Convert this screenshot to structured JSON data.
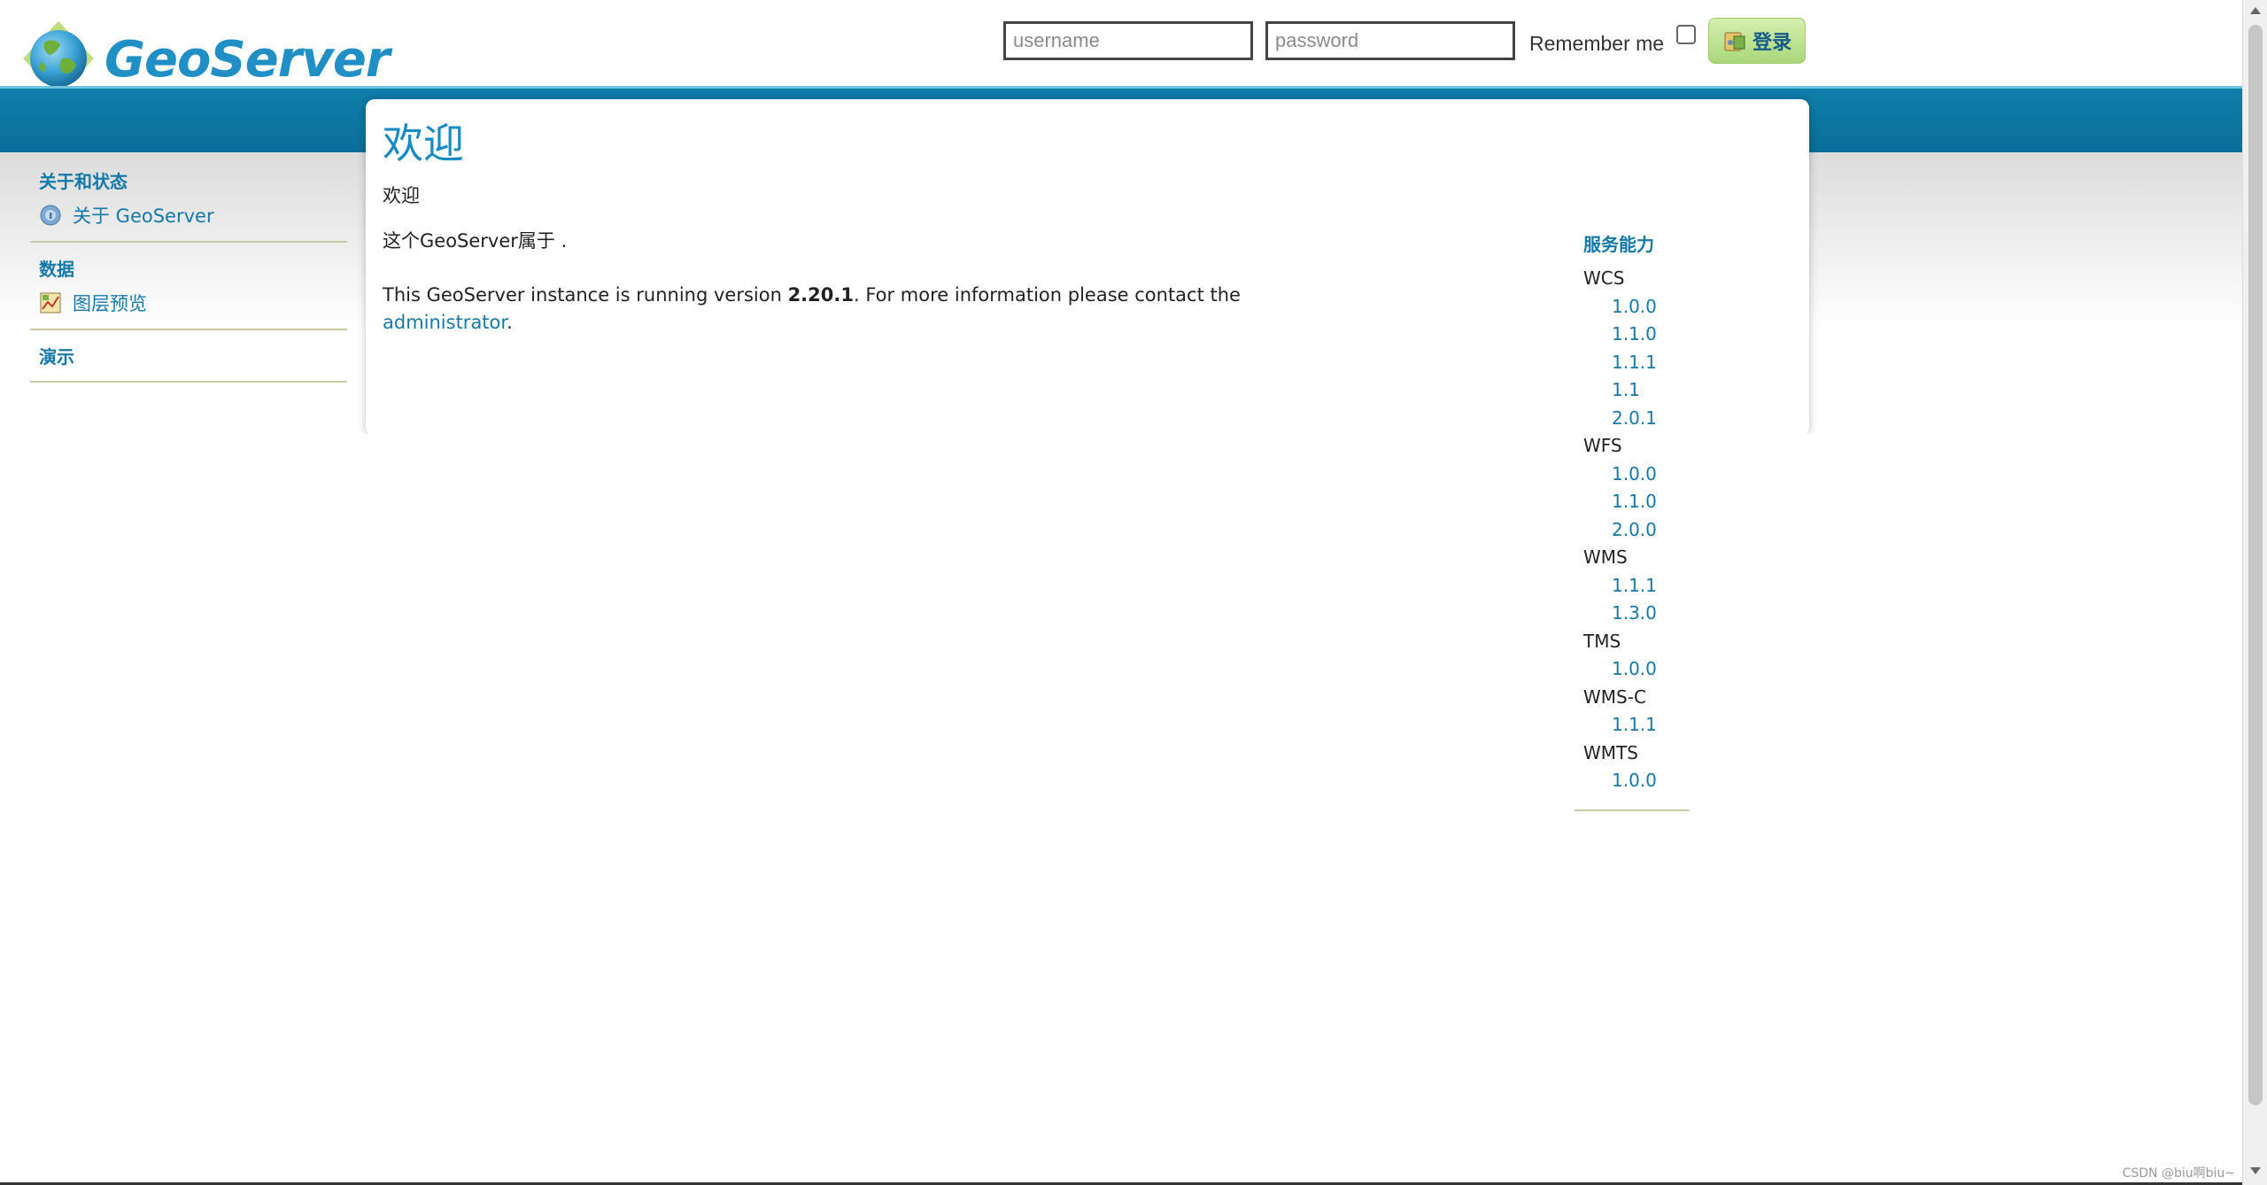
{
  "header": {
    "logo_text": "GeoServer",
    "login": {
      "username_placeholder": "username",
      "password_placeholder": "password",
      "remember_label": "Remember me",
      "button_label": "登录"
    }
  },
  "sidebar": {
    "sections": [
      {
        "heading": "关于和状态",
        "items": [
          {
            "label": "关于 GeoServer",
            "icon": "info-globe-icon"
          }
        ]
      },
      {
        "heading": "数据",
        "items": [
          {
            "label": "图层预览",
            "icon": "map-preview-icon"
          }
        ]
      },
      {
        "heading": "演示",
        "items": []
      }
    ]
  },
  "main": {
    "title": "欢迎",
    "subtitle": "欢迎",
    "owner_line": "这个GeoServer属于 .",
    "version_pre": "This GeoServer instance is running version ",
    "version": "2.20.1",
    "version_post": ". For more information please contact the",
    "admin_link": "administrator",
    "admin_post": "."
  },
  "capabilities": {
    "heading": "服务能力",
    "services": [
      {
        "name": "WCS",
        "versions": [
          "1.0.0",
          "1.1.0",
          "1.1.1",
          "1.1",
          "2.0.1"
        ]
      },
      {
        "name": "WFS",
        "versions": [
          "1.0.0",
          "1.1.0",
          "2.0.0"
        ]
      },
      {
        "name": "WMS",
        "versions": [
          "1.1.1",
          "1.3.0"
        ]
      },
      {
        "name": "TMS",
        "versions": [
          "1.0.0"
        ]
      },
      {
        "name": "WMS-C",
        "versions": [
          "1.1.1"
        ]
      },
      {
        "name": "WMTS",
        "versions": [
          "1.0.0"
        ]
      }
    ]
  },
  "watermark": "CSDN @biu啊biu~",
  "colors": {
    "accent": "#1479a8",
    "band": "#0f7fab",
    "title": "#1a8bc4"
  }
}
